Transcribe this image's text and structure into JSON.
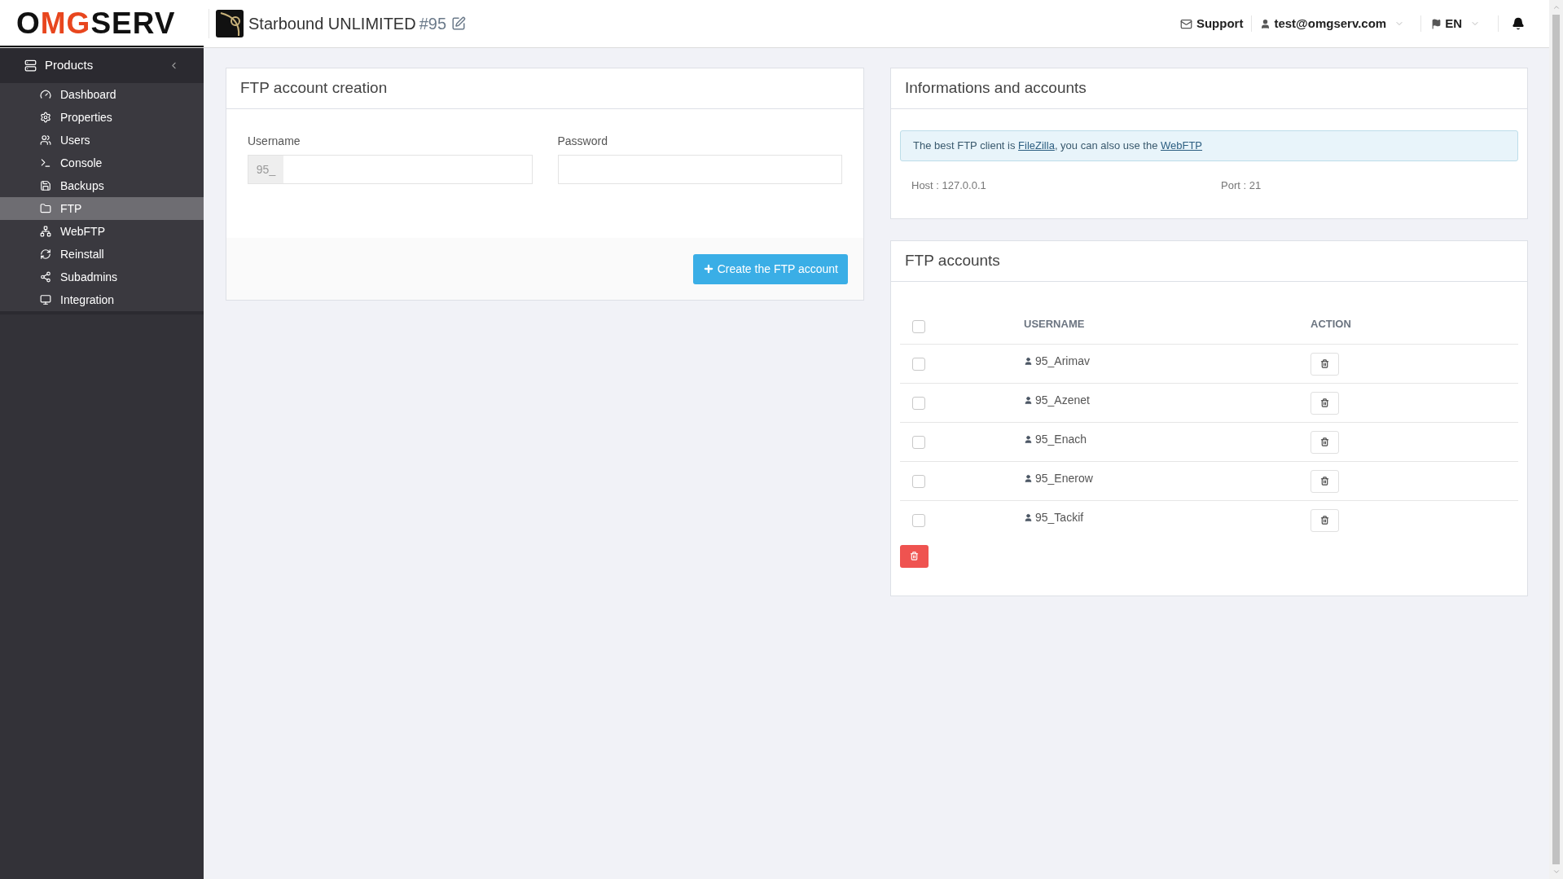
{
  "header": {
    "logo_parts": [
      {
        "text": "O",
        "kind": "plain"
      },
      {
        "text": "MG",
        "kind": "accent"
      },
      {
        "text": "SERV",
        "kind": "plain"
      }
    ],
    "server_name": "Starbound UNLIMITED",
    "server_number": "#95",
    "support": "Support",
    "account": "test@omgserv.com",
    "language": "EN"
  },
  "sidebar": {
    "title": "Products",
    "items": [
      {
        "label": "Dashboard",
        "selected": false
      },
      {
        "label": "Properties",
        "selected": false
      },
      {
        "label": "Users",
        "selected": false
      },
      {
        "label": "Console",
        "selected": false
      },
      {
        "label": "Backups",
        "selected": false
      },
      {
        "label": "FTP",
        "selected": true
      },
      {
        "label": "WebFTP",
        "selected": false
      },
      {
        "label": "Reinstall",
        "selected": false
      },
      {
        "label": "Subadmins",
        "selected": false
      },
      {
        "label": "Integration",
        "selected": false
      }
    ]
  },
  "creation_panel": {
    "title": "FTP account creation",
    "username_label": "Username",
    "username_prefix": "95_",
    "password_label": "Password",
    "create_button": "Create the FTP account"
  },
  "info_panel": {
    "title": "Informations and accounts",
    "notice_parts": [
      {
        "kind": "text",
        "text": "The best FTP client is "
      },
      {
        "kind": "link",
        "text": "FileZilla"
      },
      {
        "kind": "text",
        "text": ", you can also use the "
      },
      {
        "kind": "link",
        "text": "WebFTP"
      }
    ],
    "host": "Host : 127.0.0.1",
    "port": "Port : 21"
  },
  "accounts_panel": {
    "title": "FTP accounts",
    "columns": [
      "USERNAME",
      "ACTION"
    ],
    "all_checked": false,
    "rows": [
      {
        "username": "95_Arimav",
        "checked": false
      },
      {
        "username": "95_Azenet",
        "checked": false
      },
      {
        "username": "95_Enach",
        "checked": false
      },
      {
        "username": "95_Enerow",
        "checked": false
      },
      {
        "username": "95_Tackif",
        "checked": false
      }
    ]
  }
}
